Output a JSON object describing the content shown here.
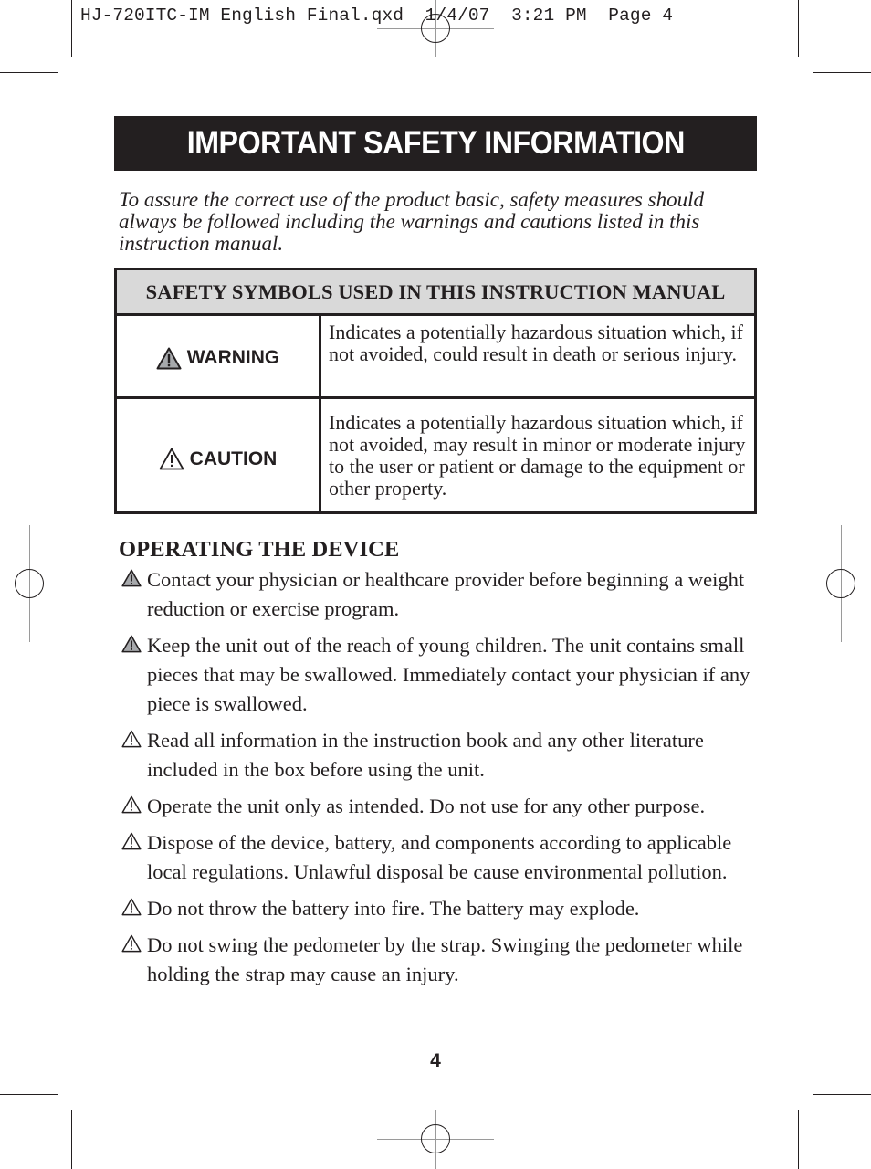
{
  "slug": "HJ-720ITC-IM English Final.qxd  1/4/07  3:21 PM  Page 4",
  "title": "IMPORTANT SAFETY INFORMATION",
  "intro": "To assure the correct use of the product basic, safety measures should always be followed including the warnings and cautions listed in this instruction manual.",
  "symbols_table": {
    "header": "SAFETY SYMBOLS USED IN THIS INSTRUCTION MANUAL",
    "rows": [
      {
        "icon": "warning-triangle-filled-icon",
        "label": "WARNING",
        "description": "Indicates a potentially hazardous situation which, if not avoided, could result in death or serious injury."
      },
      {
        "icon": "caution-triangle-outline-icon",
        "label": "CAUTION",
        "description": "Indicates a potentially hazardous situation which, if not avoided, may result in minor or moderate injury to the user or patient or damage to the equipment or other property."
      }
    ]
  },
  "operating": {
    "title": "OPERATING THE DEVICE",
    "items": [
      {
        "icon": "warning-triangle-filled-icon",
        "text": "Contact your physician or healthcare provider before beginning a weight reduction or exercise program."
      },
      {
        "icon": "warning-triangle-filled-icon",
        "text": "Keep the unit out of the reach of young children. The unit contains small pieces that may be swallowed. Immediately contact your physician if any piece is swallowed."
      },
      {
        "icon": "caution-triangle-outline-icon",
        "text": "Read all information in the instruction book and any other literature included in the box before using the unit."
      },
      {
        "icon": "caution-triangle-outline-icon",
        "text": "Operate the unit only as intended.  Do not use for any other purpose."
      },
      {
        "icon": "caution-triangle-outline-icon",
        "text": "Dispose of the device, battery, and components according to applicable local regulations. Unlawful disposal be cause environmental pollution."
      },
      {
        "icon": "caution-triangle-outline-icon",
        "text": "Do not throw the battery into fire. The battery may explode."
      },
      {
        "icon": "caution-triangle-outline-icon",
        "text": "Do not swing the pedometer by the strap. Swinging the pedometer while holding the strap may cause an injury."
      }
    ]
  },
  "page_number": "4",
  "colors": {
    "ink": "#231f20",
    "table_header_bg": "#d9d9d9",
    "warning_fill": "#a7a9ac",
    "registration_gray": "#9a9a9a"
  }
}
